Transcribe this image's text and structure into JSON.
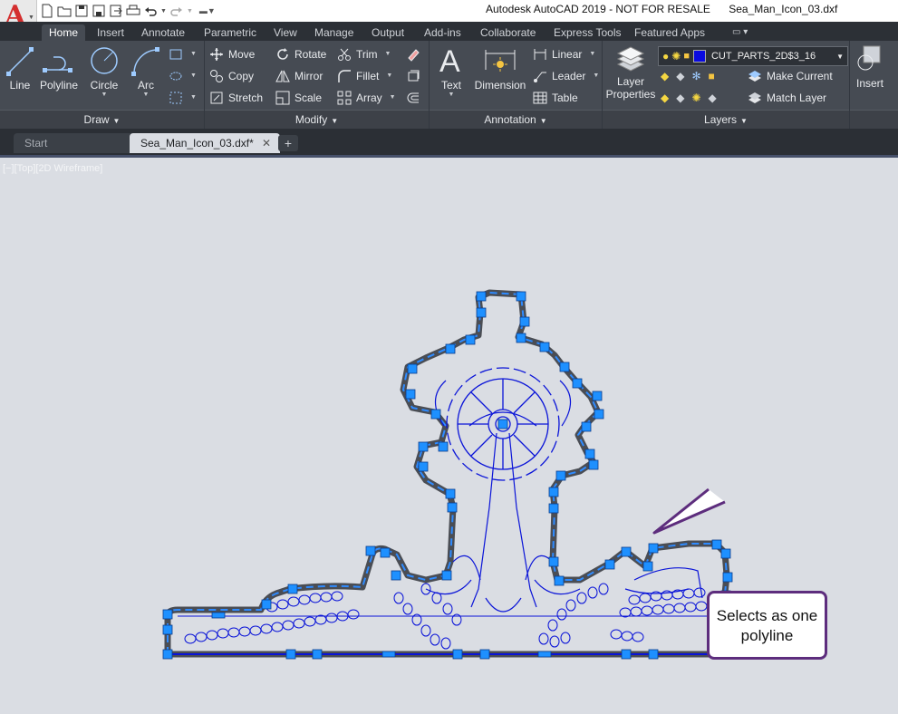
{
  "window": {
    "app_title": "Autodesk AutoCAD 2019 - NOT FOR RESALE",
    "file_title": "Sea_Man_Icon_03.dxf"
  },
  "ribbon_tabs": [
    "Home",
    "Insert",
    "Annotate",
    "Parametric",
    "View",
    "Manage",
    "Output",
    "Add-ins",
    "Collaborate",
    "Express Tools",
    "Featured Apps"
  ],
  "panels": {
    "draw": {
      "title": "Draw",
      "tools": [
        "Line",
        "Polyline",
        "Circle",
        "Arc"
      ]
    },
    "modify": {
      "title": "Modify",
      "tools": [
        "Move",
        "Rotate",
        "Trim",
        "Copy",
        "Mirror",
        "Fillet",
        "Stretch",
        "Scale",
        "Array"
      ]
    },
    "annotation": {
      "title": "Annotation",
      "tools": [
        "Text",
        "Dimension",
        "Linear",
        "Leader",
        "Table"
      ]
    },
    "layers": {
      "title": "Layers",
      "layer_properties": "Layer Properties",
      "current_layer": "CUT_PARTS_2D$3_16",
      "make_current": "Make Current",
      "match_layer": "Match Layer"
    },
    "block": {
      "insert": "Insert"
    }
  },
  "doc_tabs": {
    "start": "Start",
    "file": "Sea_Man_Icon_03.dxf*",
    "new_tab": "+"
  },
  "viewport": {
    "label": "[−][Top][2D Wireframe]"
  },
  "callout": {
    "text": "Selects as one polyline"
  },
  "colors": {
    "ribbon": "#464b53",
    "tabbar": "#2c3036",
    "canvas": "#dadde3",
    "geometry": "#0a14d8",
    "grip": "#1e90ff",
    "callout_border": "#5d2d7d",
    "layer_swatch": "#0a0ae0"
  }
}
